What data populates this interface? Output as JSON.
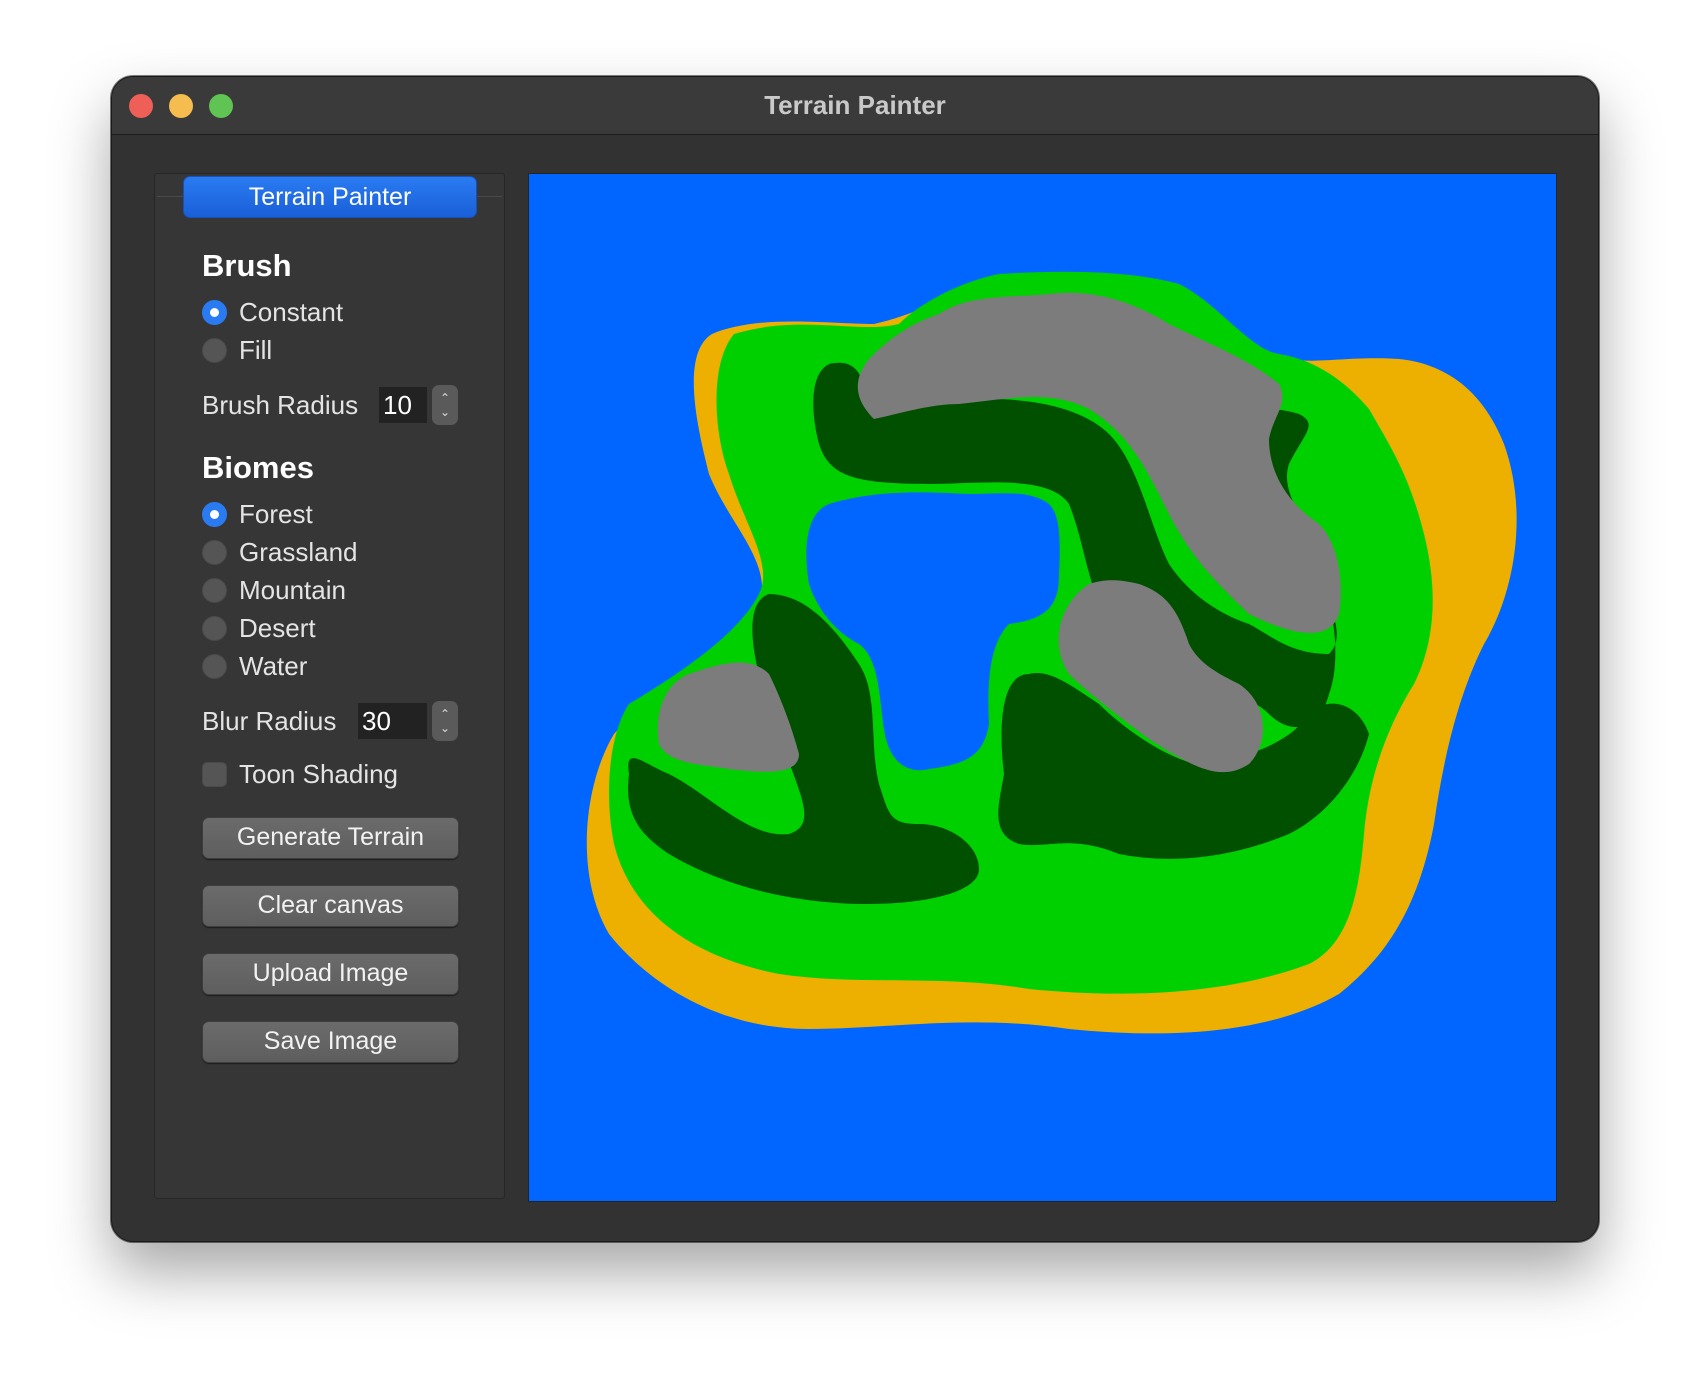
{
  "window": {
    "title": "Terrain Painter"
  },
  "sidebar": {
    "group_title": "Terrain Painter",
    "brush": {
      "heading": "Brush",
      "options": [
        {
          "label": "Constant",
          "checked": true
        },
        {
          "label": "Fill",
          "checked": false
        }
      ],
      "radius_label": "Brush Radius",
      "radius_value": "10"
    },
    "biomes": {
      "heading": "Biomes",
      "options": [
        {
          "label": "Forest",
          "checked": true
        },
        {
          "label": "Grassland",
          "checked": false
        },
        {
          "label": "Mountain",
          "checked": false
        },
        {
          "label": "Desert",
          "checked": false
        },
        {
          "label": "Water",
          "checked": false
        }
      ],
      "blur_label": "Blur Radius",
      "blur_value": "30"
    },
    "toon_shading": {
      "label": "Toon Shading",
      "checked": false
    },
    "buttons": {
      "generate": "Generate Terrain",
      "clear": "Clear canvas",
      "upload": "Upload Image",
      "save": "Save Image"
    }
  },
  "canvas": {
    "colors": {
      "water": "#0066ff",
      "desert": "#eeb000",
      "grassland": "#00d000",
      "forest": "#005000",
      "mountain": "#7c7c7c"
    }
  }
}
